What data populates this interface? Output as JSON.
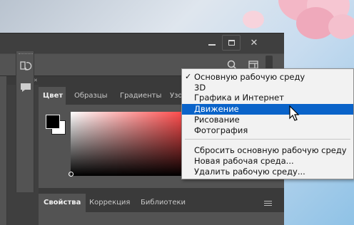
{
  "window": {
    "min_icon": "minimize-icon",
    "max_icon": "maximize-icon",
    "close_icon": "close-icon",
    "close_label": "✕"
  },
  "toolbar": {
    "search_icon": "search-icon",
    "workspace_icon": "workspace-icon",
    "collapse_label": "‹‹"
  },
  "color_panel": {
    "tabs": [
      "Цвет",
      "Образцы",
      "Градиенты",
      "Узо"
    ],
    "foreground": "#000000",
    "background": "#ffffff",
    "hue": "#ff1a1a"
  },
  "props_panel": {
    "tabs": [
      "Свойства",
      "Коррекция",
      "Библиотеки"
    ]
  },
  "workspace_menu": {
    "check_mark": "✓",
    "items": [
      "Основную рабочую среду",
      "3D",
      "Графика и Интернет",
      "Движение",
      "Рисование",
      "Фотография"
    ],
    "checked_index": 0,
    "highlighted_index": 3,
    "actions": [
      "Сбросить основную рабочую среду",
      "Новая рабочая среда...",
      "Удалить рабочую среду..."
    ]
  },
  "colors": {
    "highlight": "#0a63c9",
    "panel": "#535353",
    "dark": "#3a3a3a"
  }
}
